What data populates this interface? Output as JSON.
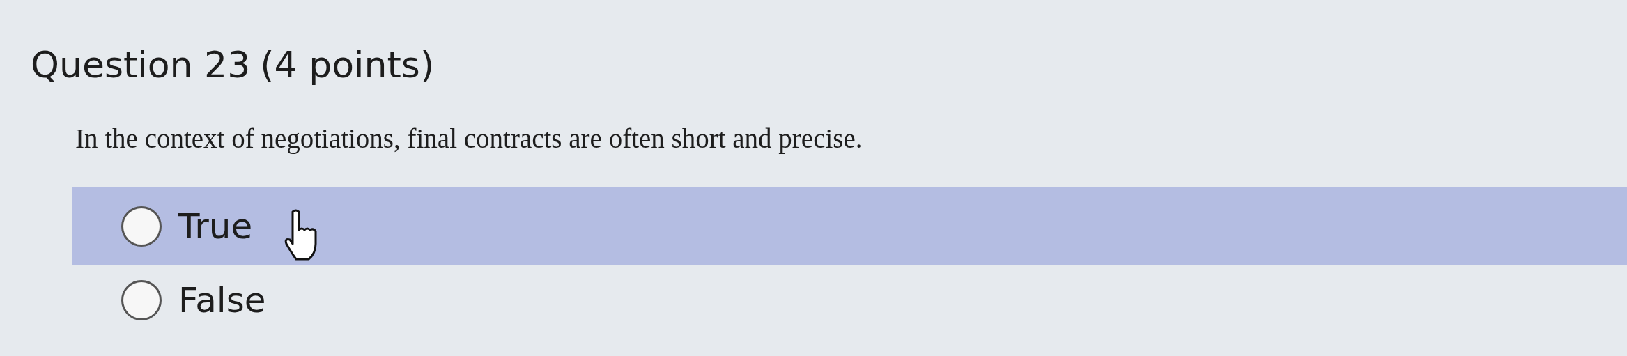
{
  "question": {
    "title": "Question 23",
    "points": "(4 points)",
    "text": "In the context of negotiations, final contracts are often short and precise."
  },
  "options": [
    {
      "label": "True",
      "selected": false,
      "hovered": true
    },
    {
      "label": "False",
      "selected": false,
      "hovered": false
    }
  ]
}
